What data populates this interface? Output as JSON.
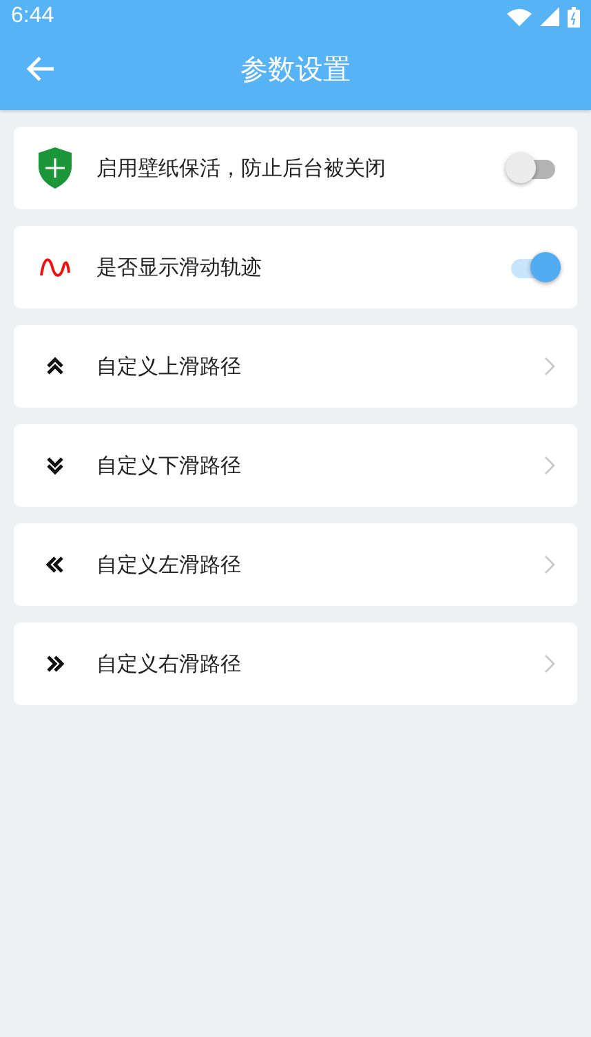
{
  "status_bar": {
    "time": "6:44"
  },
  "toolbar": {
    "title": "参数设置"
  },
  "settings": [
    {
      "kind": "toggle",
      "label": "启用壁纸保活，防止后台被关闭",
      "on": false
    },
    {
      "kind": "toggle",
      "label": "是否显示滑动轨迹",
      "on": true
    },
    {
      "kind": "link",
      "label": "自定义上滑路径"
    },
    {
      "kind": "link",
      "label": "自定义下滑路径"
    },
    {
      "kind": "link",
      "label": "自定义左滑路径"
    },
    {
      "kind": "link",
      "label": "自定义右滑路径"
    }
  ]
}
